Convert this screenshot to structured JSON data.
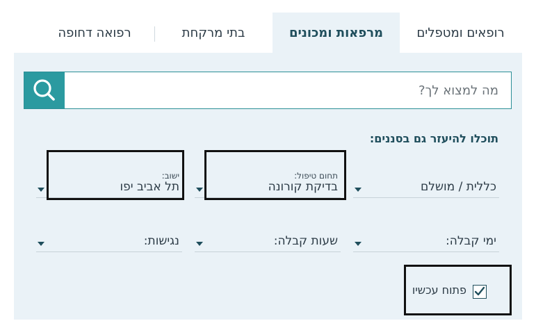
{
  "tabs": [
    {
      "label": "רופאים ומטפלים",
      "active": false
    },
    {
      "label": "מרפאות ומכונים",
      "active": true
    },
    {
      "label": "בתי מרקחת",
      "active": false
    },
    {
      "label": "רפואה דחופה",
      "active": false
    }
  ],
  "search": {
    "placeholder": "מה למצוא לך?"
  },
  "filters_heading": "תוכלו להיעזר גם בסננים:",
  "filters": {
    "health_fund": {
      "value": "כללית / מושלם"
    },
    "treatment_area": {
      "label": "תחום טיפול:",
      "value": "בדיקת קורונה"
    },
    "city": {
      "label": "ישוב:",
      "value": "תל אביב יפו"
    },
    "reception_days": {
      "value": "ימי קבלה:"
    },
    "reception_hours": {
      "value": "שעות קבלה:"
    },
    "accessibility": {
      "value": "נגישות:"
    }
  },
  "open_now": {
    "label": "פתוח עכשיו",
    "checked": true
  },
  "colors": {
    "accent": "#2b9aa0",
    "panel": "#eaf2f7",
    "text": "#1f4e5c"
  }
}
